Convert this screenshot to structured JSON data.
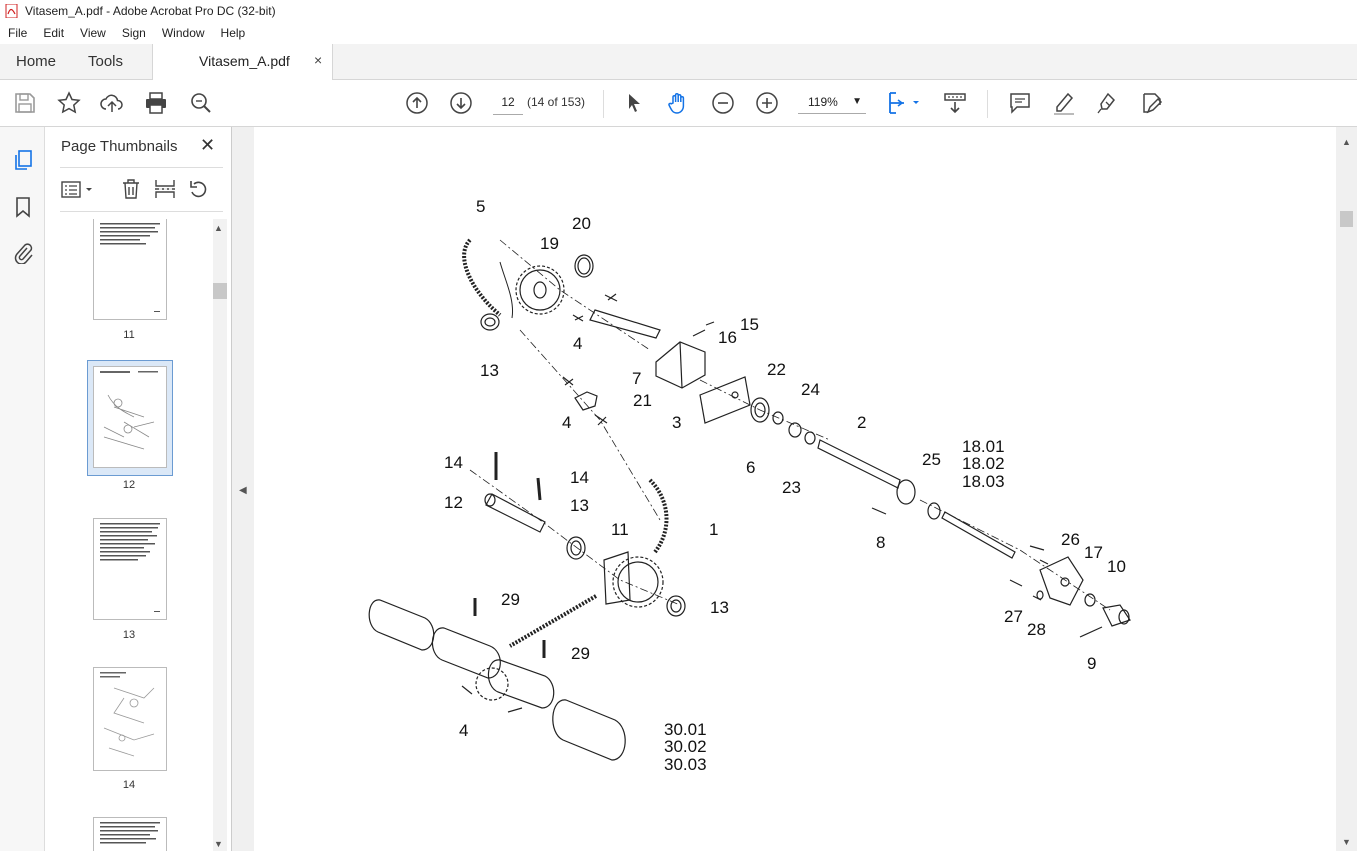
{
  "window": {
    "title": "Vitasem_A.pdf - Adobe Acrobat Pro DC (32-bit)"
  },
  "menu": [
    "File",
    "Edit",
    "View",
    "Sign",
    "Window",
    "Help"
  ],
  "tabs": {
    "home": "Home",
    "tools": "Tools",
    "document": "Vitasem_A.pdf",
    "close": "×"
  },
  "toolbar": {
    "page_input": "12",
    "page_count": "(14 of 153)",
    "zoom": "119%"
  },
  "panel": {
    "title": "Page Thumbnails",
    "close": "✕",
    "thumbnails": [
      {
        "label": "11",
        "selected": false
      },
      {
        "label": "12",
        "selected": true
      },
      {
        "label": "13",
        "selected": false
      },
      {
        "label": "14",
        "selected": false
      }
    ]
  },
  "callouts": [
    {
      "id": "c5",
      "text": "5"
    },
    {
      "id": "c19",
      "text": "19"
    },
    {
      "id": "c20",
      "text": "20"
    },
    {
      "id": "c13a",
      "text": "13"
    },
    {
      "id": "c4a",
      "text": "4"
    },
    {
      "id": "c7",
      "text": "7"
    },
    {
      "id": "c15",
      "text": "15"
    },
    {
      "id": "c16",
      "text": "16"
    },
    {
      "id": "c3",
      "text": "3"
    },
    {
      "id": "c21",
      "text": "21"
    },
    {
      "id": "c4b",
      "text": "4"
    },
    {
      "id": "c22",
      "text": "22"
    },
    {
      "id": "c24",
      "text": "24"
    },
    {
      "id": "c6",
      "text": "6"
    },
    {
      "id": "c23",
      "text": "23"
    },
    {
      "id": "c2",
      "text": "2"
    },
    {
      "id": "c18a",
      "text": "18.01"
    },
    {
      "id": "c18b",
      "text": "18.02"
    },
    {
      "id": "c18c",
      "text": "18.03"
    },
    {
      "id": "c25",
      "text": "25"
    },
    {
      "id": "c8",
      "text": "8"
    },
    {
      "id": "c14a",
      "text": "14"
    },
    {
      "id": "c14b",
      "text": "14"
    },
    {
      "id": "c12",
      "text": "12"
    },
    {
      "id": "c13b",
      "text": "13"
    },
    {
      "id": "c11",
      "text": "11"
    },
    {
      "id": "c1",
      "text": "1"
    },
    {
      "id": "c13c",
      "text": "13"
    },
    {
      "id": "c26",
      "text": "26"
    },
    {
      "id": "c17",
      "text": "17"
    },
    {
      "id": "c10",
      "text": "10"
    },
    {
      "id": "c27",
      "text": "27"
    },
    {
      "id": "c28",
      "text": "28"
    },
    {
      "id": "c9",
      "text": "9"
    },
    {
      "id": "c29a",
      "text": "29"
    },
    {
      "id": "c29b",
      "text": "29"
    },
    {
      "id": "c4c",
      "text": "4"
    },
    {
      "id": "c30a",
      "text": "30.01"
    },
    {
      "id": "c30b",
      "text": "30.02"
    },
    {
      "id": "c30c",
      "text": "30.03"
    }
  ]
}
